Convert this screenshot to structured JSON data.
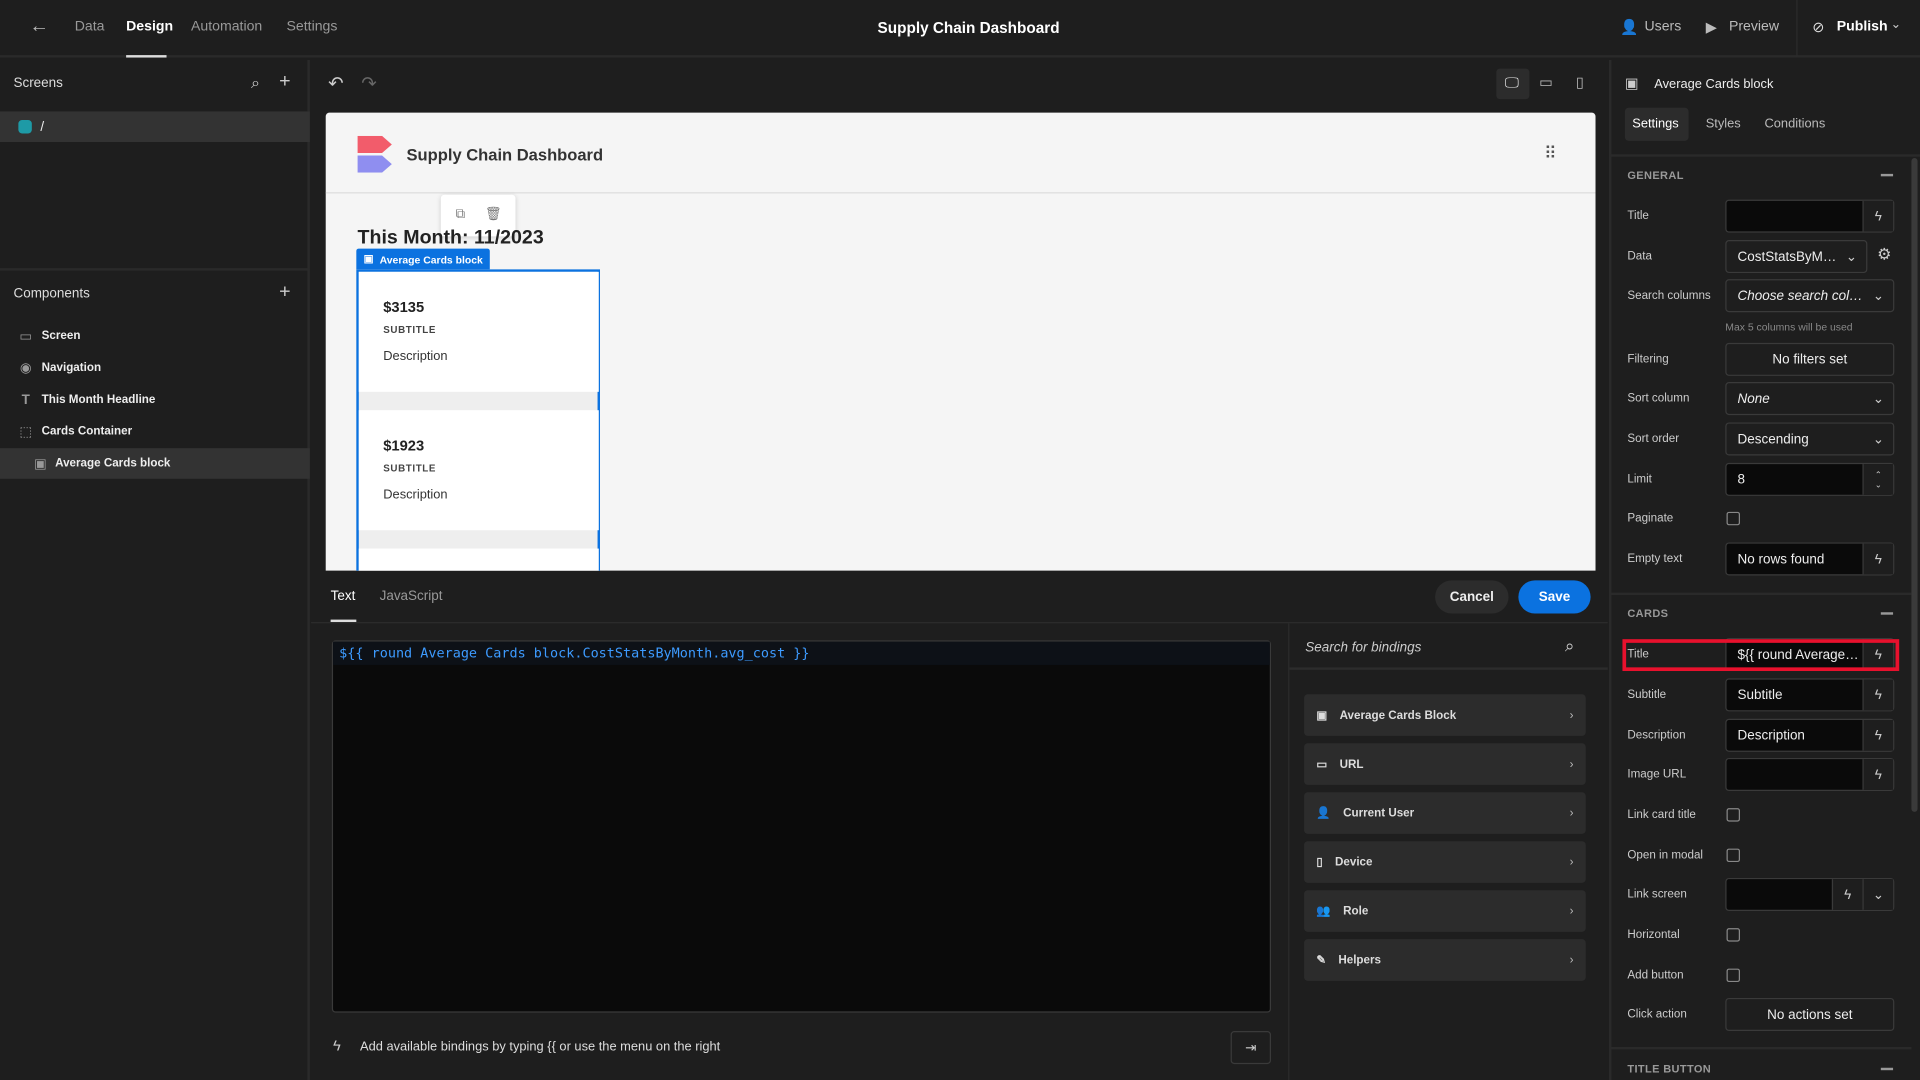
{
  "topbar": {
    "nav": [
      "Data",
      "Design",
      "Automation",
      "Settings"
    ],
    "active": "Design",
    "title": "Supply Chain Dashboard",
    "users": "Users",
    "preview": "Preview",
    "publish": "Publish"
  },
  "screens": {
    "header": "Screens",
    "items": [
      {
        "label": "/",
        "color": "#1e9aa6"
      }
    ]
  },
  "components": {
    "header": "Components",
    "items": [
      {
        "label": "Screen",
        "icon": "screen-icon"
      },
      {
        "label": "Navigation",
        "icon": "eye-icon"
      },
      {
        "label": "This Month Headline",
        "icon": "text-icon"
      },
      {
        "label": "Cards Container",
        "icon": "container-icon"
      },
      {
        "label": "Average Cards block",
        "icon": "cards-block-icon",
        "selected": true
      }
    ]
  },
  "preview": {
    "app_title": "Supply Chain Dashboard",
    "headline": "This Month: 11/2023",
    "block_label": "Average Cards block",
    "cards": [
      {
        "title": "$3135",
        "subtitle": "SUBTITLE",
        "description": "Description"
      },
      {
        "title": "$1923",
        "subtitle": "SUBTITLE",
        "description": "Description"
      }
    ]
  },
  "editor": {
    "tabs": [
      "Text",
      "JavaScript"
    ],
    "active_tab": "Text",
    "cancel": "Cancel",
    "save": "Save",
    "code": "${{ round Average Cards block.CostStatsByMonth.avg_cost }}",
    "hint": "Add available bindings by typing {{ or use the menu on the right",
    "accent": "#0b72e0"
  },
  "bindings": {
    "search_placeholder": "Search for bindings",
    "items": [
      "Average Cards Block",
      "URL",
      "Current User",
      "Device",
      "Role",
      "Helpers"
    ]
  },
  "settings": {
    "component": "Average Cards block",
    "tabs": [
      "Settings",
      "Styles",
      "Conditions"
    ],
    "general": {
      "header": "GENERAL",
      "title_label": "Title",
      "title_value": "",
      "data_label": "Data",
      "data_value": "CostStatsByM…",
      "search_label": "Search columns",
      "search_placeholder": "Choose search col…",
      "search_hint": "Max 5 columns will be used",
      "filter_label": "Filtering",
      "filter_value": "No filters set",
      "sortcol_label": "Sort column",
      "sortcol_value": "None",
      "sortorder_label": "Sort order",
      "sortorder_value": "Descending",
      "limit_label": "Limit",
      "limit_value": "8",
      "paginate_label": "Paginate",
      "empty_label": "Empty text",
      "empty_value": "No rows found"
    },
    "cards": {
      "header": "CARDS",
      "title_label": "Title",
      "title_value": "${{ round Average…",
      "subtitle_label": "Subtitle",
      "subtitle_value": "Subtitle",
      "desc_label": "Description",
      "desc_value": "Description",
      "image_label": "Image URL",
      "linktitle_label": "Link card title",
      "modal_label": "Open in modal",
      "linkscreen_label": "Link screen",
      "horizontal_label": "Horizontal",
      "addbutton_label": "Add button",
      "click_label": "Click action",
      "click_value": "No actions set"
    },
    "title_button": {
      "header": "TITLE BUTTON"
    }
  }
}
